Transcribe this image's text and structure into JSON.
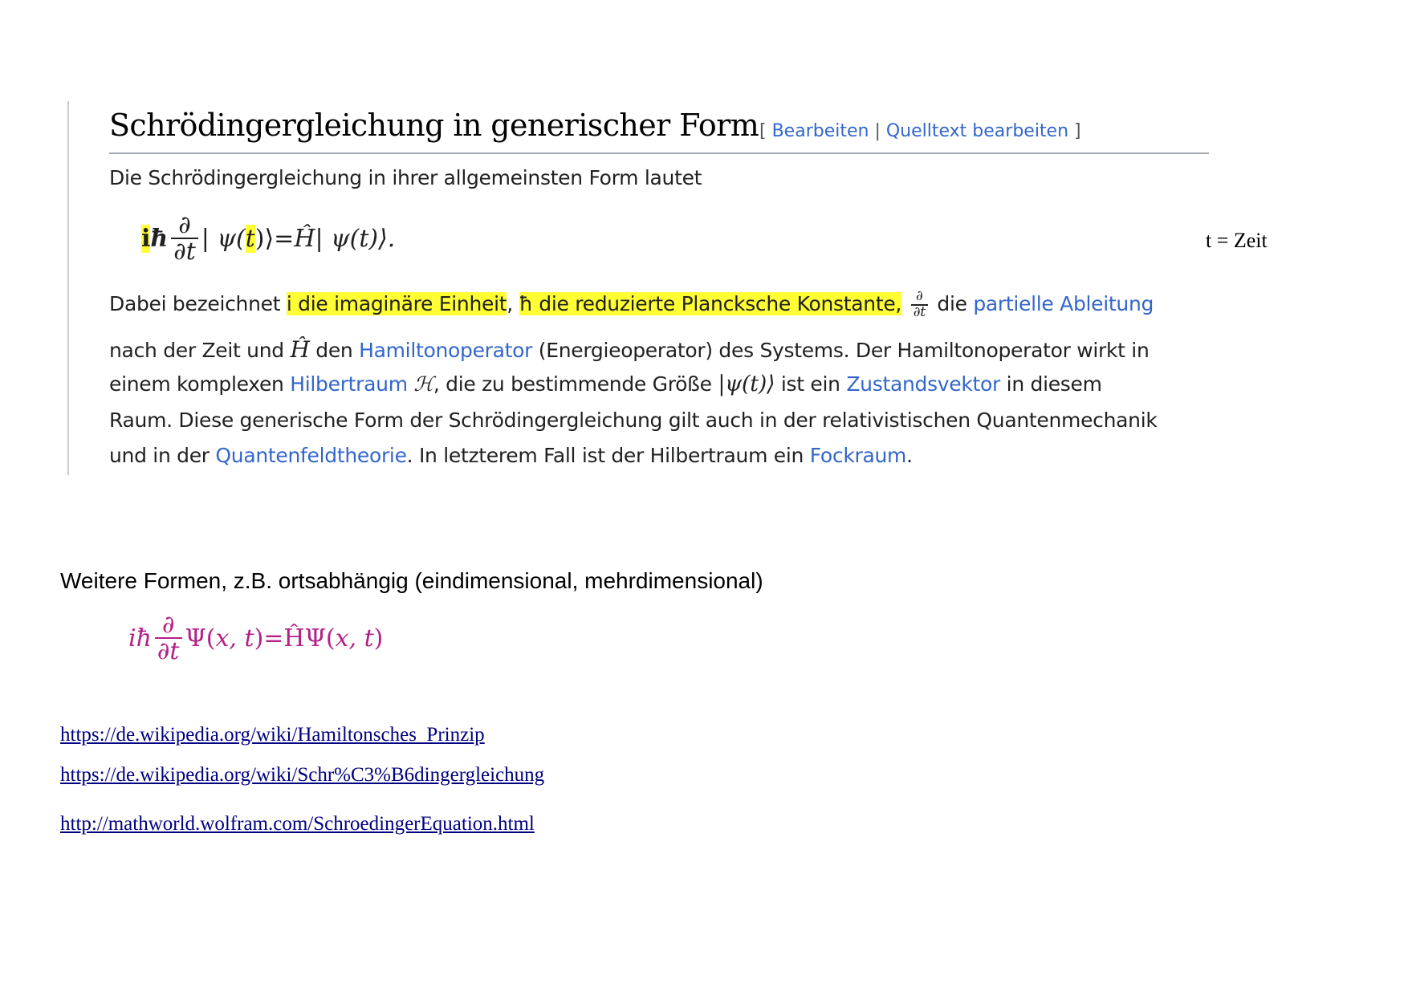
{
  "wiki": {
    "heading": "Schrödingergleichung in generischer Form",
    "edit_open": "[ ",
    "edit_link": "Bearbeiten",
    "edit_sep": " | ",
    "source_edit_link": "Quelltext bearbeiten",
    "edit_close": " ]",
    "intro": "Die Schrödingergleichung in ihrer allgemeinsten Form lautet",
    "equation": {
      "i": "i",
      "hbar": "ħ",
      "num": "∂",
      "den": "∂t",
      "ket_open": "|",
      "psi": "ψ(",
      "t": "t",
      "ket_close": ")⟩",
      "equals": " = ",
      "rhs": "Ĥ| ψ(t)⟩."
    },
    "para": {
      "l1_a": "Dabei bezeichnet ",
      "l1_hl1": "i die imaginäre Einheit",
      "l1_b": ", ",
      "l1_hl2": "ħ die reduzierte Plancksche Konstante,",
      "l1_frac_num": "∂",
      "l1_frac_den": "∂t",
      "l1_c": " die ",
      "l1_link": "partielle Ableitung",
      "l2_a": "nach der Zeit und ",
      "l2_H": "Ĥ",
      "l2_b": " den ",
      "l2_link": "Hamiltonoperator",
      "l2_c": " (Energieoperator) des Systems. Der Hamiltonoperator wirkt in",
      "l3_a": "einem komplexen ",
      "l3_link": "Hilbertraum",
      "l3_H": " ℋ",
      "l3_b": ", die zu bestimmende Größe ",
      "l3_ket": "|ψ(t)⟩",
      "l3_c": " ist ein ",
      "l3_link2": "Zustandsvektor",
      "l3_d": " in diesem",
      "l4": "Raum. Diese generische Form der Schrödingergleichung gilt auch in der relativistischen Quantenmechanik",
      "l5_a": "und in der ",
      "l5_link": "Quantenfeldtheorie",
      "l5_b": ". In letzterem Fall ist der Hilbertraum ein ",
      "l5_link2": "Fockraum",
      "l5_c": "."
    }
  },
  "note": "t = Zeit",
  "subheading": "Weitere Formen, z.B. ortsabhängig (eindimensional, mehrdimensional)",
  "equation2": {
    "lhs": "iħ",
    "num": "∂",
    "den": "∂t",
    "psi": "Ψ(",
    "vars": "x, t",
    "close": ")",
    "equals": " = ",
    "rhs_op": "ĤΨ(",
    "rhs_vars": "x, t",
    "rhs_close": ")"
  },
  "links": [
    "https://de.wikipedia.org/wiki/Hamiltonsches_Prinzip",
    "https://de.wikipedia.org/wiki/Schr%C3%B6dingergleichung",
    "http://mathworld.wolfram.com/SchroedingerEquation.html"
  ],
  "colors": {
    "link_blue": "#3366cc",
    "highlight": "#ffff33",
    "equation_magenta": "#b32087",
    "hyperlink_navy": "#000080"
  }
}
